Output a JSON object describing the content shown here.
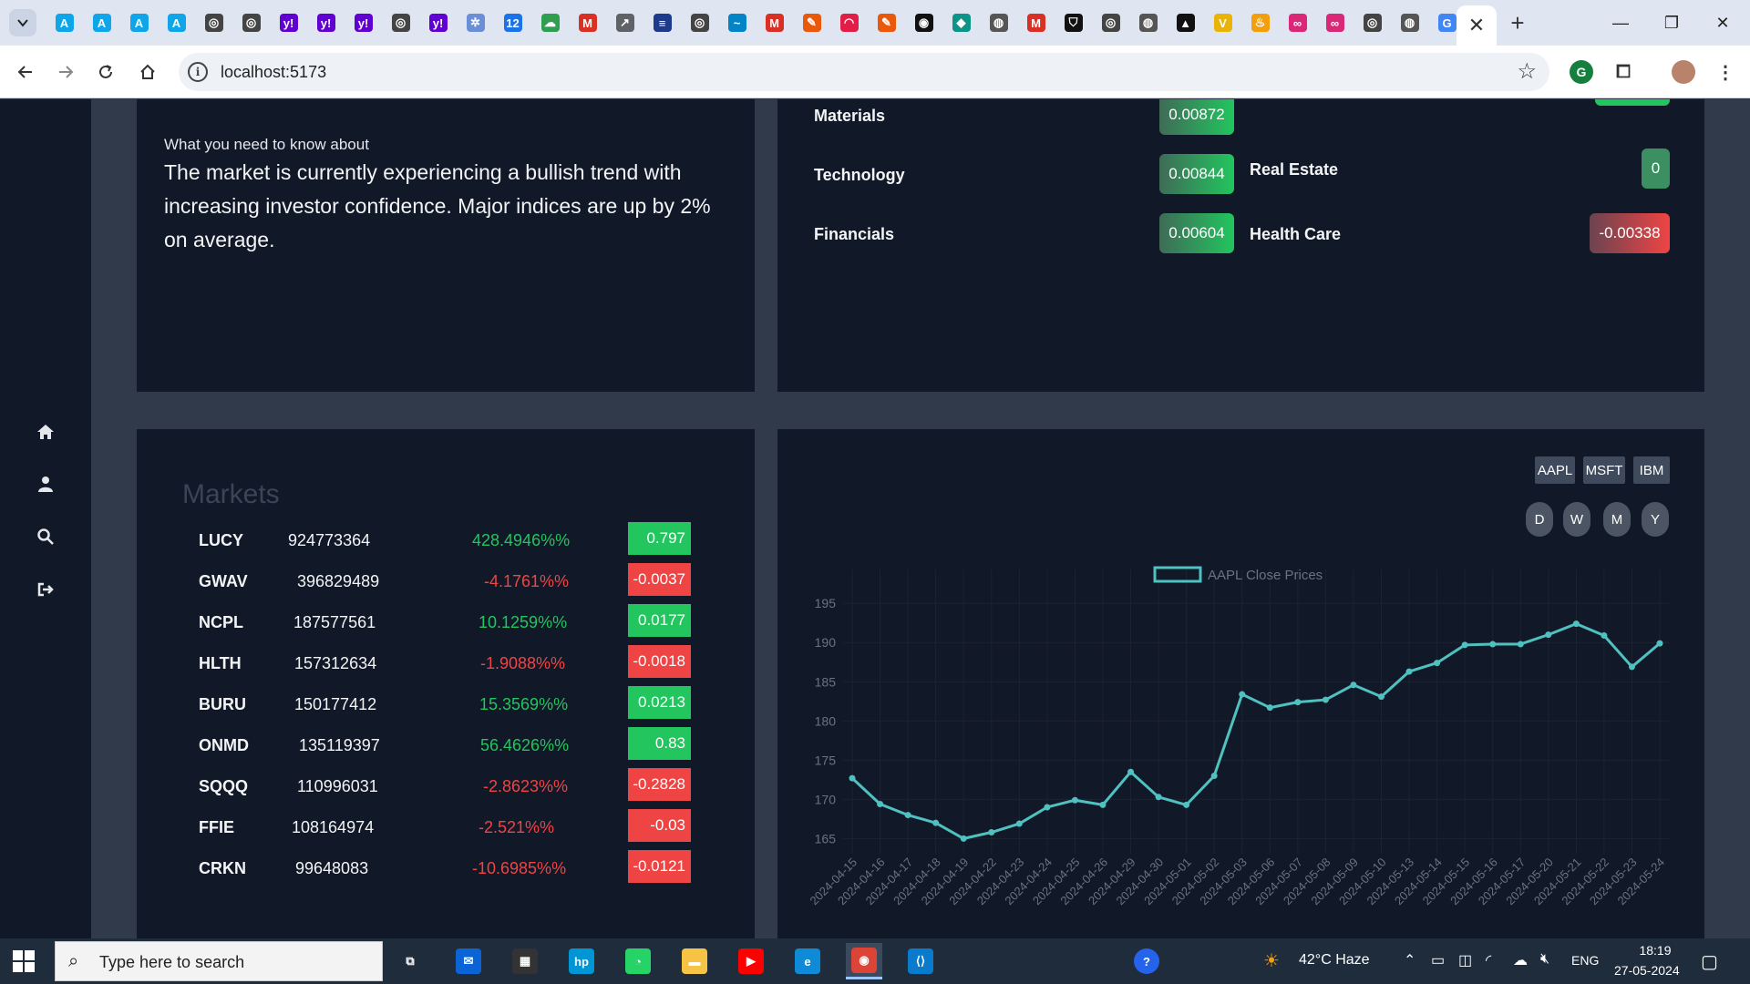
{
  "browser": {
    "url": "localhost:5173",
    "tabs": [
      {
        "icon": "tab-favicon-a1",
        "glyph": "A",
        "bg": "#0ea5e9"
      },
      {
        "icon": "tab-favicon-a2",
        "glyph": "A",
        "bg": "#0ea5e9"
      },
      {
        "icon": "tab-favicon-a3",
        "glyph": "A",
        "bg": "#0ea5e9"
      },
      {
        "icon": "tab-favicon-a4",
        "glyph": "A",
        "bg": "#0ea5e9"
      },
      {
        "icon": "tab-favicon-openai1",
        "glyph": "◎",
        "bg": "#444"
      },
      {
        "icon": "tab-favicon-openai2",
        "glyph": "◎",
        "bg": "#444"
      },
      {
        "icon": "tab-favicon-yahoo1",
        "glyph": "y!",
        "bg": "#6001d2"
      },
      {
        "icon": "tab-favicon-yahoo2",
        "glyph": "y!",
        "bg": "#6001d2"
      },
      {
        "icon": "tab-favicon-yahoo3",
        "glyph": "y!",
        "bg": "#6001d2"
      },
      {
        "icon": "tab-favicon-openai3",
        "glyph": "◎",
        "bg": "#444"
      },
      {
        "icon": "tab-favicon-yahoo4",
        "glyph": "y!",
        "bg": "#6001d2"
      },
      {
        "icon": "tab-favicon-gear",
        "glyph": "✲",
        "bg": "#6b8fd6"
      },
      {
        "icon": "tab-favicon-12",
        "glyph": "12",
        "bg": "#1a73e8"
      },
      {
        "icon": "tab-favicon-cloud",
        "glyph": "☁",
        "bg": "#2e9e4f"
      },
      {
        "icon": "tab-favicon-gmail1",
        "glyph": "M",
        "bg": "#d93025"
      },
      {
        "icon": "tab-favicon-chart",
        "glyph": "↗",
        "bg": "#5f6368"
      },
      {
        "icon": "tab-favicon-stack",
        "glyph": "≡",
        "bg": "#1e3a8a"
      },
      {
        "icon": "tab-favicon-openai4",
        "glyph": "◎",
        "bg": "#444"
      },
      {
        "icon": "tab-favicon-wave",
        "glyph": "~",
        "bg": "#0284c7"
      },
      {
        "icon": "tab-favicon-gmail2",
        "glyph": "M",
        "bg": "#d93025"
      },
      {
        "icon": "tab-favicon-pen1",
        "glyph": "✎",
        "bg": "#ea580c"
      },
      {
        "icon": "tab-favicon-arc",
        "glyph": "◠",
        "bg": "#e11d48"
      },
      {
        "icon": "tab-favicon-pen2",
        "glyph": "✎",
        "bg": "#ea580c"
      },
      {
        "icon": "tab-favicon-github",
        "glyph": "◉",
        "bg": "#111"
      },
      {
        "icon": "tab-favicon-diamond",
        "glyph": "◆",
        "bg": "#0d9488"
      },
      {
        "icon": "tab-favicon-globe1",
        "glyph": "◍",
        "bg": "#555"
      },
      {
        "icon": "tab-favicon-gmail3",
        "glyph": "M",
        "bg": "#d93025"
      },
      {
        "icon": "tab-favicon-shield",
        "glyph": "⛉",
        "bg": "#111"
      },
      {
        "icon": "tab-favicon-openai5",
        "glyph": "◎",
        "bg": "#444"
      },
      {
        "icon": "tab-favicon-globe2",
        "glyph": "◍",
        "bg": "#555"
      },
      {
        "icon": "tab-favicon-triangle",
        "glyph": "▲",
        "bg": "#111"
      },
      {
        "icon": "tab-favicon-v",
        "glyph": "V",
        "bg": "#eab308"
      },
      {
        "icon": "tab-favicon-flame",
        "glyph": "♨",
        "bg": "#f59e0b"
      },
      {
        "icon": "tab-favicon-pink1",
        "glyph": "∞",
        "bg": "#db2777"
      },
      {
        "icon": "tab-favicon-pink2",
        "glyph": "∞",
        "bg": "#db2777"
      },
      {
        "icon": "tab-favicon-openai6",
        "glyph": "◎",
        "bg": "#444"
      },
      {
        "icon": "tab-favicon-globe3",
        "glyph": "◍",
        "bg": "#555"
      },
      {
        "icon": "tab-favicon-google",
        "glyph": "G",
        "bg": "#4285f4"
      }
    ],
    "active_tab_close": "✕",
    "new_tab": "+",
    "minimize": "—",
    "restore": "❐",
    "close": "✕"
  },
  "info": {
    "lead": "What you need to know about",
    "body": "The market is currently experiencing a bullish trend with increasing investor confidence. Major indices are up by 2% on average."
  },
  "sectors": {
    "materials": {
      "name": "Materials",
      "value": "0.00872"
    },
    "technology": {
      "name": "Technology",
      "value": "0.00844"
    },
    "financials": {
      "name": "Financials",
      "value": "0.00604"
    },
    "real_estate": {
      "name": "Real Estate",
      "value": "0"
    },
    "health_care": {
      "name": "Health Care",
      "value": "-0.00338"
    }
  },
  "markets": {
    "title": "Markets",
    "rows": [
      {
        "symbol": "LUCY",
        "volume": "924773364",
        "percent": "428.4946%%",
        "change": "0.797",
        "up": true
      },
      {
        "symbol": "GWAV",
        "volume": "396829489",
        "percent": "-4.1761%%",
        "change": "-0.0037",
        "up": false
      },
      {
        "symbol": "NCPL",
        "volume": "187577561",
        "percent": "10.1259%%",
        "change": "0.0177",
        "up": true
      },
      {
        "symbol": "HLTH",
        "volume": "157312634",
        "percent": "-1.9088%%",
        "change": "-0.0018",
        "up": false
      },
      {
        "symbol": "BURU",
        "volume": "150177412",
        "percent": "15.3569%%",
        "change": "0.0213",
        "up": true
      },
      {
        "symbol": "ONMD",
        "volume": "135119397",
        "percent": "56.4626%%",
        "change": "0.83",
        "up": true
      },
      {
        "symbol": "SQQQ",
        "volume": "110996031",
        "percent": "-2.8623%%",
        "change": "-0.2828",
        "up": false
      },
      {
        "symbol": "FFIE",
        "volume": "108164974",
        "percent": "-2.521%%",
        "change": "-0.03",
        "up": false
      },
      {
        "symbol": "CRKN",
        "volume": "99648083",
        "percent": "-10.6985%%",
        "change": "-0.0121",
        "up": false
      }
    ]
  },
  "chart_controls": {
    "tickers": [
      "AAPL",
      "MSFT",
      "IBM"
    ],
    "ranges": [
      "D",
      "W",
      "M",
      "Y"
    ]
  },
  "colors": {
    "up": "#22c55e",
    "down": "#ef4444",
    "line": "#4fc1c0",
    "card": "#111827",
    "page": "#313a4a"
  },
  "chart_data": {
    "type": "line",
    "title": "",
    "xlabel": "",
    "ylabel": "",
    "legend": "top-center",
    "grid": true,
    "ylim": [
      164,
      197
    ],
    "yticks": [
      165,
      170,
      175,
      180,
      185,
      190,
      195
    ],
    "x": [
      "2024-04-15",
      "2024-04-16",
      "2024-04-17",
      "2024-04-18",
      "2024-04-19",
      "2024-04-22",
      "2024-04-23",
      "2024-04-24",
      "2024-04-25",
      "2024-04-26",
      "2024-04-29",
      "2024-04-30",
      "2024-05-01",
      "2024-05-02",
      "2024-05-03",
      "2024-05-06",
      "2024-05-07",
      "2024-05-08",
      "2024-05-09",
      "2024-05-10",
      "2024-05-13",
      "2024-05-14",
      "2024-05-15",
      "2024-05-16",
      "2024-05-17",
      "2024-05-20",
      "2024-05-21",
      "2024-05-22",
      "2024-05-23",
      "2024-05-24"
    ],
    "series": [
      {
        "name": "AAPL Close Prices",
        "values": [
          172.7,
          169.4,
          168.0,
          167.0,
          165.0,
          165.8,
          166.9,
          169.0,
          169.9,
          169.3,
          173.5,
          170.3,
          169.3,
          173.0,
          183.4,
          181.7,
          182.4,
          182.7,
          184.6,
          183.1,
          186.3,
          187.4,
          189.7,
          189.8,
          189.8,
          191.0,
          192.4,
          190.9,
          186.9,
          189.9
        ]
      }
    ]
  },
  "taskbar": {
    "search_placeholder": "Type here to search",
    "weather": "42°C  Haze",
    "lang": "ENG",
    "time": "18:19",
    "date": "27-05-2024",
    "apps": [
      {
        "icon": "task-view-icon",
        "glyph": "⧉",
        "bg": "transparent"
      },
      {
        "icon": "mail-icon",
        "glyph": "✉",
        "bg": "#0a64d6"
      },
      {
        "icon": "store-icon",
        "glyph": "▦",
        "bg": "#333"
      },
      {
        "icon": "myhp-icon",
        "glyph": "hp",
        "bg": "#0096d6"
      },
      {
        "icon": "whatsapp-icon",
        "glyph": "◔",
        "bg": "#25d366"
      },
      {
        "icon": "file-explorer-icon",
        "glyph": "▬",
        "bg": "#f6c344"
      },
      {
        "icon": "youtube-icon",
        "glyph": "▶",
        "bg": "#ff0000"
      },
      {
        "icon": "edge-icon",
        "glyph": "e",
        "bg": "#0f8ad6"
      },
      {
        "icon": "chrome-icon",
        "glyph": "◉",
        "bg": "#db4437"
      },
      {
        "icon": "vscode-icon",
        "glyph": "⟨⟩",
        "bg": "#0a7acc"
      }
    ]
  }
}
